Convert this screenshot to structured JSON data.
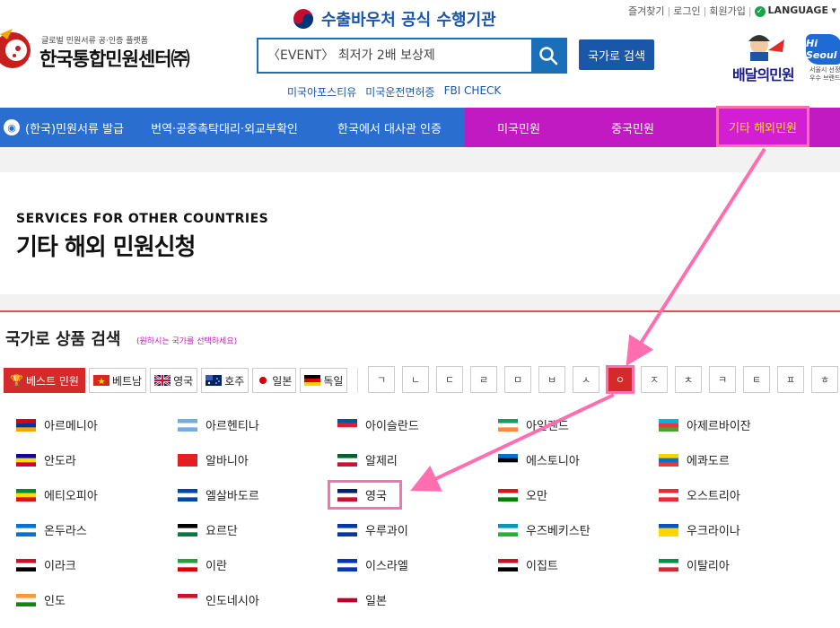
{
  "header": {
    "top_links": [
      "즐겨찾기",
      "로그인",
      "회원가입"
    ],
    "language": "LANGUAGE",
    "logo_sub": "글로벌 민원서류 공·인증 플랫폼",
    "logo_main": "한국통합민원센터㈜",
    "customs_text": "수출바우처 공식 수행기관",
    "search_placeholder": "〈EVENT〉 최저가 2배 보상제",
    "country_search_button": "국가로 검색",
    "quick_links": [
      "미국아포스티유",
      "미국운전면허증",
      "FBI CHECK"
    ],
    "delivery_text": "배달의민원",
    "hiseoul_text": "Hi Seoul",
    "hiseoul_caption": [
      "서울시 선정",
      "우수 브랜드"
    ]
  },
  "nav": {
    "blue_items": [
      "(한국)민원서류 발급",
      "번역·공증촉탁대리·외교부확인",
      "한국에서 대사관 인증"
    ],
    "pink_items": [
      "미국민원",
      "중국민원",
      "기타 해외민원"
    ]
  },
  "section": {
    "title_en": "SERVICES FOR OTHER COUNTRIES",
    "title_ko": "기타 해외 민원신청"
  },
  "country_search": {
    "title": "국가로 상품 검색",
    "hint": "(원하시는 국가를 선택하세요)",
    "chips": [
      {
        "label": "베스트 민원",
        "icon": "trophy-icon"
      },
      {
        "label": "베트남",
        "icon": "vietnam-flag-icon"
      },
      {
        "label": "영국",
        "icon": "uk-flag-icon"
      },
      {
        "label": "호주",
        "icon": "australia-flag-icon"
      },
      {
        "label": "일본",
        "icon": "japan-flag-icon"
      },
      {
        "label": "독일",
        "icon": "germany-flag-icon"
      }
    ],
    "consonants": [
      "ㄱ",
      "ㄴ",
      "ㄷ",
      "ㄹ",
      "ㅁ",
      "ㅂ",
      "ㅅ",
      "ㅇ",
      "ㅈ",
      "ㅊ",
      "ㅋ",
      "ㅌ",
      "ㅍ",
      "ㅎ"
    ],
    "active_consonant": "ㅇ",
    "countries": [
      {
        "name": "아르메니아",
        "colors": [
          "#d90012",
          "#0033a0",
          "#f2a800"
        ]
      },
      {
        "name": "아르헨티나",
        "colors": [
          "#74acdf",
          "#ffffff",
          "#74acdf"
        ]
      },
      {
        "name": "아이슬란드",
        "colors": [
          "#02529c",
          "#dc1e35",
          "#ffffff"
        ]
      },
      {
        "name": "아일랜드",
        "colors": [
          "#169b62",
          "#ffffff",
          "#ff883e"
        ]
      },
      {
        "name": "아제르바이잔",
        "colors": [
          "#00b5e2",
          "#ef3340",
          "#509e2f"
        ]
      },
      {
        "name": "안도라",
        "colors": [
          "#10069f",
          "#fedd00",
          "#d50032"
        ]
      },
      {
        "name": "알바니아",
        "colors": [
          "#e41e20",
          "#e41e20",
          "#e41e20"
        ]
      },
      {
        "name": "알제리",
        "colors": [
          "#006233",
          "#ffffff",
          "#d21034"
        ]
      },
      {
        "name": "에스토니아",
        "colors": [
          "#0072ce",
          "#000000",
          "#ffffff"
        ]
      },
      {
        "name": "에콰도르",
        "colors": [
          "#ffd100",
          "#0072ce",
          "#ef3340"
        ]
      },
      {
        "name": "에티오피아",
        "colors": [
          "#078930",
          "#fcdd09",
          "#da121a"
        ]
      },
      {
        "name": "엘살바도르",
        "colors": [
          "#0047ab",
          "#ffffff",
          "#0047ab"
        ]
      },
      {
        "name": "영국",
        "colors": [
          "#012169",
          "#ffffff",
          "#c8102e"
        ]
      },
      {
        "name": "오만",
        "colors": [
          "#db161b",
          "#ffffff",
          "#008000"
        ]
      },
      {
        "name": "오스트리아",
        "colors": [
          "#ed2939",
          "#ffffff",
          "#ed2939"
        ]
      },
      {
        "name": "온두라스",
        "colors": [
          "#0073cf",
          "#ffffff",
          "#0073cf"
        ]
      },
      {
        "name": "요르단",
        "colors": [
          "#000000",
          "#ffffff",
          "#007a3d"
        ]
      },
      {
        "name": "우루과이",
        "colors": [
          "#0038a8",
          "#ffffff",
          "#0038a8"
        ]
      },
      {
        "name": "우즈베키스탄",
        "colors": [
          "#0099b5",
          "#ffffff",
          "#1eb53a"
        ]
      },
      {
        "name": "우크라이나",
        "colors": [
          "#0057b7",
          "#ffd700",
          "#ffd700"
        ]
      },
      {
        "name": "이라크",
        "colors": [
          "#ce1126",
          "#ffffff",
          "#000000"
        ]
      },
      {
        "name": "이란",
        "colors": [
          "#239f40",
          "#ffffff",
          "#da0000"
        ]
      },
      {
        "name": "이스라엘",
        "colors": [
          "#0038b8",
          "#ffffff",
          "#0038b8"
        ]
      },
      {
        "name": "이집트",
        "colors": [
          "#ce1126",
          "#ffffff",
          "#000000"
        ]
      },
      {
        "name": "이탈리아",
        "colors": [
          "#009246",
          "#ffffff",
          "#ce2b37"
        ]
      },
      {
        "name": "인도",
        "colors": [
          "#ff9933",
          "#ffffff",
          "#138808"
        ]
      },
      {
        "name": "인도네시아",
        "colors": [
          "#ce1126",
          "#ffffff",
          "#ffffff"
        ]
      },
      {
        "name": "일본",
        "colors": [
          "#ffffff",
          "#bc002d",
          "#ffffff"
        ]
      }
    ],
    "highlighted_country": "영국"
  },
  "colors": {
    "nav_blue": "#2a6fd0",
    "nav_pink": "#c21ac2",
    "accent_red": "#d42a2a",
    "annotation_pink": "#ff6fb0",
    "brand_blue": "#1a57a8"
  }
}
